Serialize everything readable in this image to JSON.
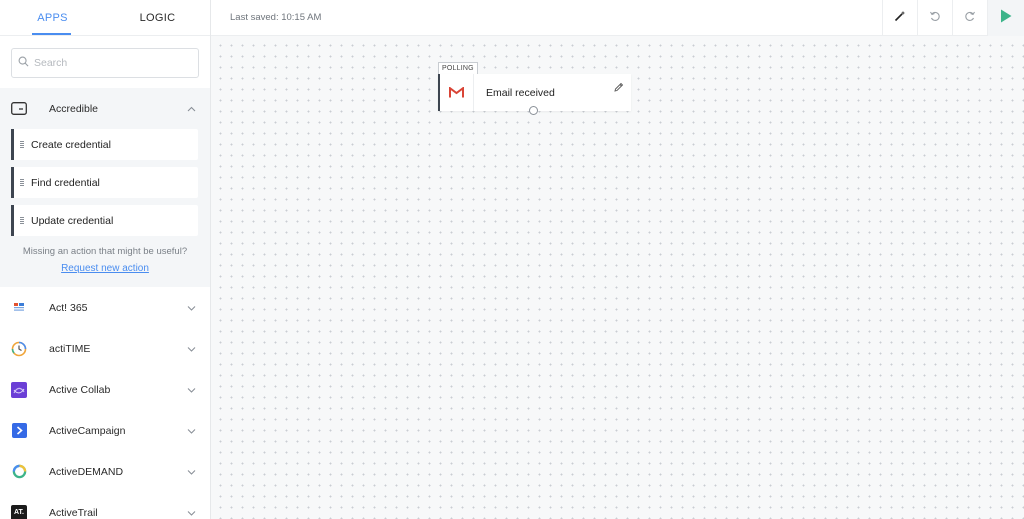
{
  "tabs": [
    {
      "label": "APPS",
      "active": true
    },
    {
      "label": "LOGIC",
      "active": false
    }
  ],
  "search": {
    "placeholder": "Search"
  },
  "expanded_app": {
    "name": "Accredible",
    "icon": "card-icon",
    "actions": [
      {
        "label": "Create credential"
      },
      {
        "label": "Find credential"
      },
      {
        "label": "Update credential"
      }
    ],
    "missing_text": "Missing an action that might be useful?",
    "request_link": "Request new action"
  },
  "apps": [
    {
      "name": "Act! 365",
      "icon": "act365-icon"
    },
    {
      "name": "actiTIME",
      "icon": "actitime-icon"
    },
    {
      "name": "Active Collab",
      "icon": "active-collab-icon"
    },
    {
      "name": "ActiveCampaign",
      "icon": "activecampaign-icon"
    },
    {
      "name": "ActiveDEMAND",
      "icon": "activedemand-icon"
    },
    {
      "name": "ActiveTrail",
      "icon": "activetrail-icon",
      "icon_text": "AT."
    }
  ],
  "topbar": {
    "last_saved": "Last saved: 10:15 AM",
    "tools": [
      "magic-wand-icon",
      "undo-icon",
      "redo-icon",
      "play-icon"
    ]
  },
  "canvas": {
    "node": {
      "tag": "POLLING",
      "title": "Email received",
      "icon": "gmail-icon"
    }
  },
  "colors": {
    "accent": "#4a8df0",
    "run": "#3db48a",
    "gmail_red": "#d94436",
    "node_border": "#3d4550"
  }
}
